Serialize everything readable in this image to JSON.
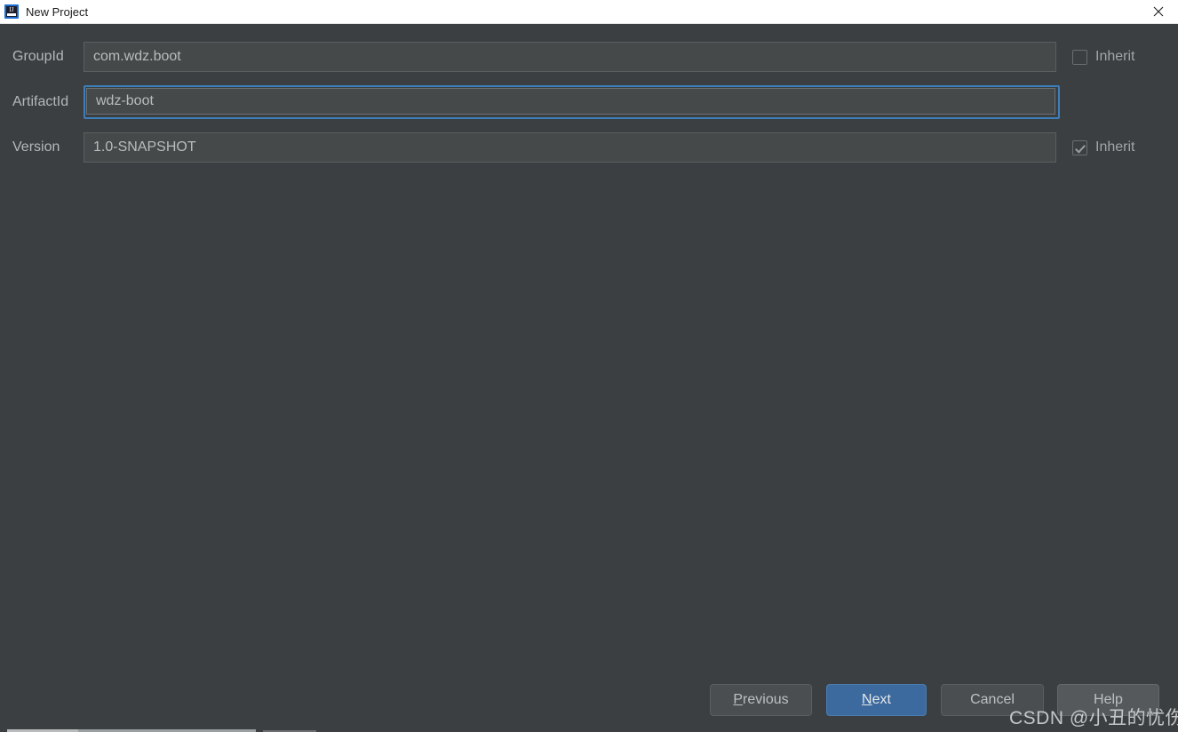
{
  "window": {
    "title": "New Project",
    "app_icon": "intellij-idea-icon",
    "icon_text": "IJ",
    "close_icon": "close-icon"
  },
  "form": {
    "fields": [
      {
        "label": "GroupId",
        "value": "com.wdz.boot",
        "focused": false,
        "inherit": {
          "label": "Inherit",
          "checked": false,
          "visible": true
        }
      },
      {
        "label": "ArtifactId",
        "value": "wdz-boot",
        "focused": true,
        "inherit": {
          "label": "",
          "checked": false,
          "visible": false
        }
      },
      {
        "label": "Version",
        "value": "1.0-SNAPSHOT",
        "focused": false,
        "inherit": {
          "label": "Inherit",
          "checked": true,
          "visible": true
        }
      }
    ]
  },
  "buttons": {
    "previous": {
      "label": "Previous",
      "mnemonic": "P",
      "rest": "revious"
    },
    "next": {
      "label": "Next",
      "mnemonic": "N",
      "rest": "ext",
      "default": true
    },
    "cancel": {
      "label": "Cancel"
    },
    "help": {
      "label": "Help"
    }
  },
  "watermark": {
    "text": "CSDN @小丑的忧伤"
  },
  "colors": {
    "dialog_background": "#3c3f41",
    "titlebar_background": "#ffffff",
    "field_background": "#45494a",
    "focus_border": "#3d7fba",
    "default_button": "#3c6a9e",
    "label_text": "#b4b7b8"
  }
}
